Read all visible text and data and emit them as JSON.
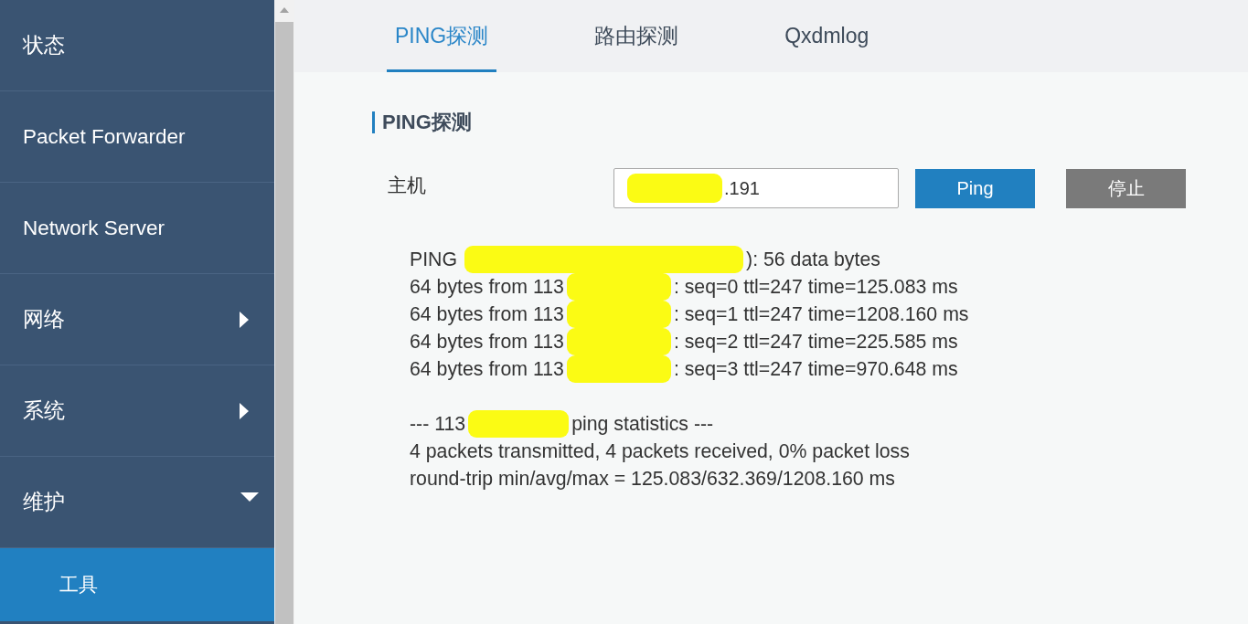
{
  "sidebar": {
    "items": [
      {
        "label": "状态",
        "kind": "link",
        "selected": false
      },
      {
        "label": "Packet Forwarder",
        "kind": "link",
        "selected": false
      },
      {
        "label": "Network Server",
        "kind": "link",
        "selected": false
      },
      {
        "label": "网络",
        "kind": "group",
        "expanded": false,
        "selected": false
      },
      {
        "label": "系统",
        "kind": "group",
        "expanded": false,
        "selected": false
      },
      {
        "label": "维护",
        "kind": "group",
        "expanded": true,
        "selected": false,
        "children": [
          {
            "label": "工具",
            "selected": true
          }
        ]
      }
    ]
  },
  "tabs": [
    {
      "label": "PING探测",
      "selected": true
    },
    {
      "label": "路由探测",
      "selected": false
    },
    {
      "label": "Qxdmlog",
      "selected": false
    }
  ],
  "section": {
    "title": "PING探测"
  },
  "host": {
    "label": "主机",
    "value": ".191",
    "redacted": true
  },
  "buttons": [
    {
      "label": "Ping",
      "kind": "primary"
    },
    {
      "label": "停止",
      "kind": "secondary"
    }
  ],
  "output": {
    "blocks": [
      {
        "lines": [
          {
            "before": "PING",
            "redacted": true,
            "after": "): 56 data bytes"
          },
          {
            "before": "64 bytes from 113",
            "redacted": true,
            "after": ": seq=0 ttl=247 time=125.083 ms"
          },
          {
            "before": "64 bytes from 113",
            "redacted": true,
            "after": ": seq=1 ttl=247 time=1208.160 ms"
          },
          {
            "before": "64 bytes from 113",
            "redacted": true,
            "after": ": seq=2 ttl=247 time=225.585 ms"
          },
          {
            "before": "64 bytes from 113",
            "redacted": true,
            "after": ": seq=3 ttl=247 time=970.648 ms"
          }
        ]
      },
      {
        "lines": [
          {
            "before": "--- 113",
            "redacted": true,
            "after": "ping statistics ---"
          },
          {
            "before": "4 packets transmitted, 4 packets received, 0% packet loss"
          },
          {
            "before": "round-trip min/avg/max = 125.083/632.369/1208.160 ms"
          }
        ]
      }
    ]
  }
}
